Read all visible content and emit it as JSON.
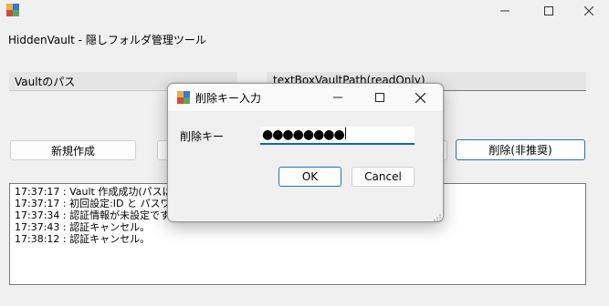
{
  "window": {
    "icon": "app-icon",
    "title": "HiddenVault - 隠しフォルダ管理ツール",
    "controls": [
      "minimize-icon",
      "maximize-icon",
      "close-icon"
    ]
  },
  "vault_path": {
    "label": "Vaultのパス",
    "value": "textBoxVaultPath(readOnly)"
  },
  "buttons": {
    "create": "新規作成",
    "delete": "削除(非推奨)"
  },
  "log": {
    "lines": [
      "17:37:17 : Vault 作成成功(パスはま",
      "17:37:17 : 初回設定:ID と パスワー",
      "17:37:34 : 認証情報が未設定です。",
      "17:37:43 : 認証キャンセル。",
      "17:38:12 : 認証キャンセル。"
    ]
  },
  "dialog": {
    "title": "削除キー入力",
    "key_label": "削除キー",
    "key_value": "●●●●●●●●",
    "ok": "OK",
    "cancel": "Cancel",
    "accent_color": "#0a64c8"
  }
}
